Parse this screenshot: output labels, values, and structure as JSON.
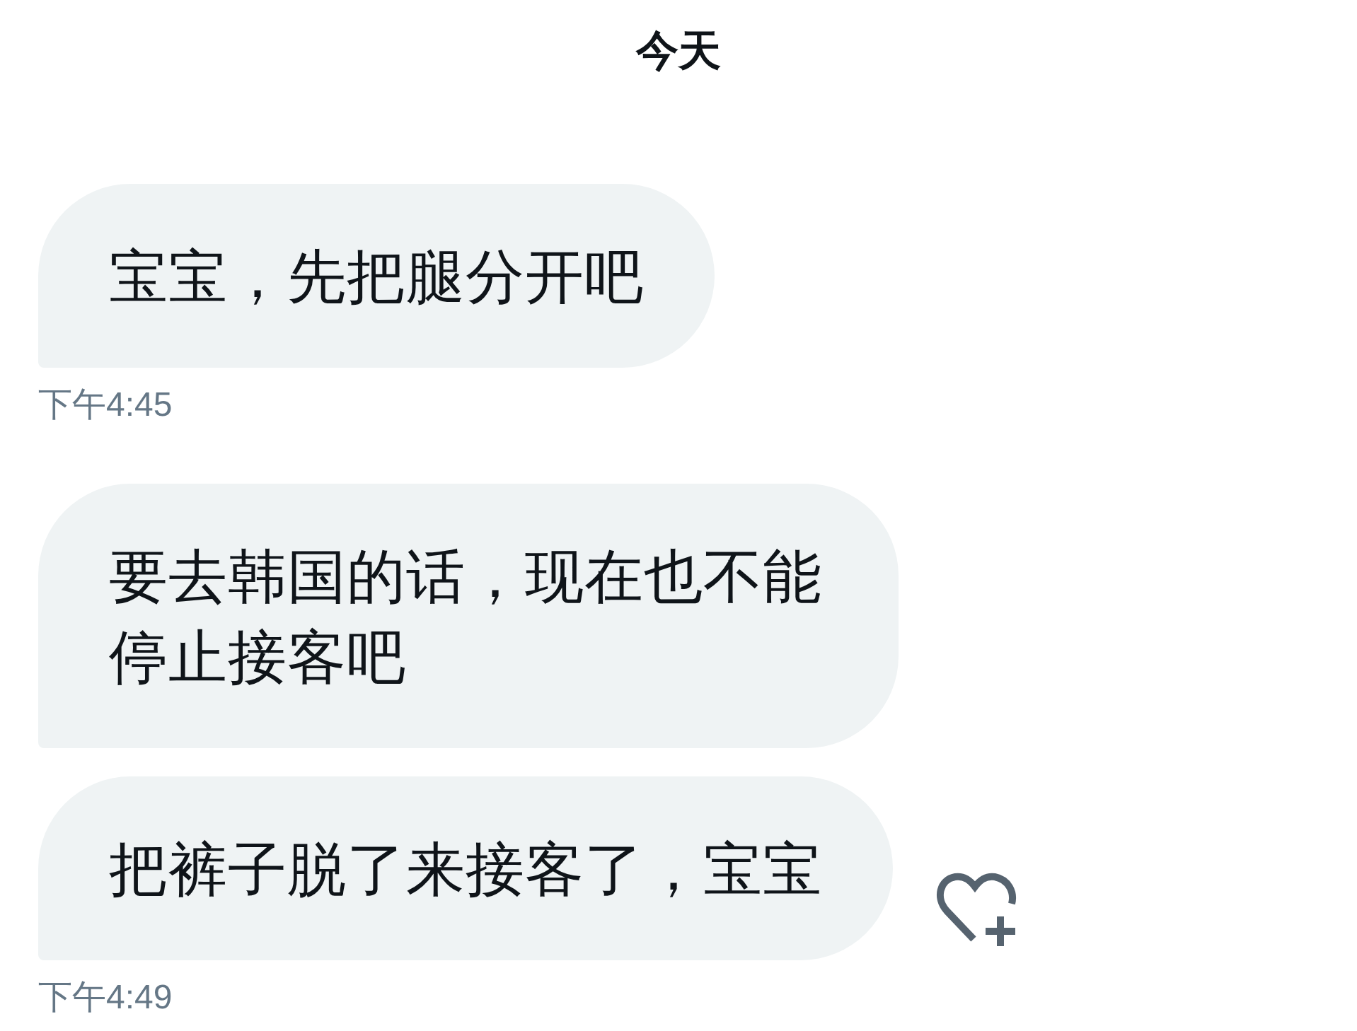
{
  "date_header": "今天",
  "messages": [
    {
      "text": "宝宝，先把腿分开吧",
      "timestamp": "下午4:45",
      "reaction_button": false
    },
    {
      "text": "要去韩国的话，现在也不能停止接客吧",
      "reaction_button": false
    },
    {
      "text": "把裤子脱了来接客了，宝宝",
      "timestamp": "下午4:49",
      "reaction_button": true
    }
  ]
}
